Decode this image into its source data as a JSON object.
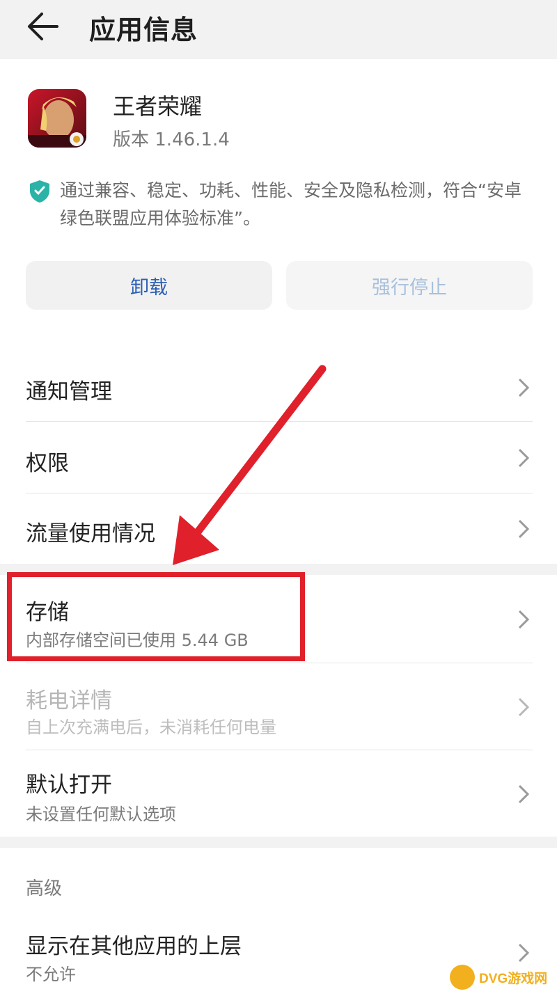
{
  "header": {
    "title": "应用信息"
  },
  "app": {
    "name": "王者荣耀",
    "version": "版本 1.46.1.4"
  },
  "certification": {
    "text": "通过兼容、稳定、功耗、性能、安全及隐私检测，符合“安卓绿色联盟应用体验标准”。"
  },
  "actions": {
    "uninstall_label": "卸载",
    "force_stop_label": "强行停止"
  },
  "settings": {
    "notification": {
      "title": "通知管理"
    },
    "permissions": {
      "title": "权限"
    },
    "data_usage": {
      "title": "流量使用情况"
    },
    "storage": {
      "title": "存储",
      "subtitle": "内部存储空间已使用 5.44 GB"
    },
    "battery": {
      "title": "耗电详情",
      "subtitle": "自上次充满电后，未消耗任何电量"
    },
    "open_by_default": {
      "title": "默认打开",
      "subtitle": "未设置任何默认选项"
    }
  },
  "advanced": {
    "section_label": "高级",
    "overlay": {
      "title": "显示在其他应用的上层",
      "subtitle": "不允许"
    }
  },
  "watermark": {
    "text": "DVG游戏网"
  },
  "colors": {
    "accent": "#2a5fb5",
    "highlight": "#e0202a",
    "shield": "#2bb3a8"
  },
  "icons": {
    "back": "arrow-left-icon",
    "shield": "shield-check-icon",
    "chevron": "chevron-right-icon"
  }
}
